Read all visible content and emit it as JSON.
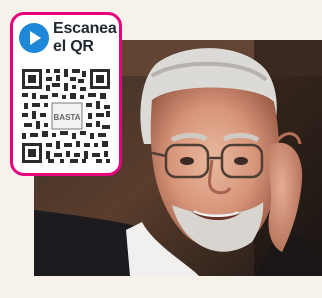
{
  "qr_callout": {
    "line1": "Escanea",
    "line2": "el QR",
    "icon": "play-icon",
    "qr_center_text": "BASTA",
    "border_color": "#e6007e",
    "badge_color": "#1e88d8"
  },
  "photo": {
    "subject": "portrait-photo"
  }
}
